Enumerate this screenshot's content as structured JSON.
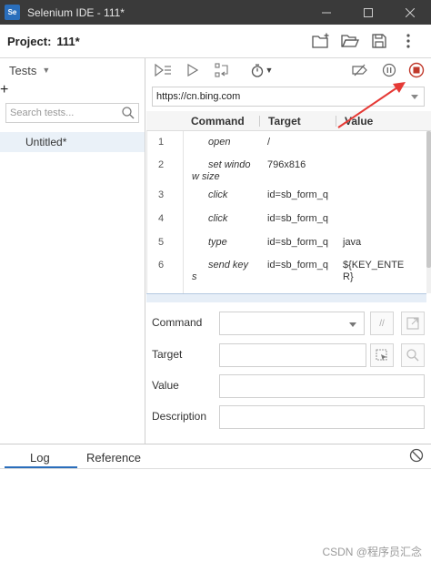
{
  "window": {
    "logo_text": "Se",
    "title": "Selenium IDE - 111*"
  },
  "project": {
    "label": "Project:",
    "name": "111*"
  },
  "sidebar": {
    "section_label": "Tests",
    "search_placeholder": "Search tests...",
    "tests": [
      {
        "name": "Untitled*",
        "selected": true
      }
    ]
  },
  "toolbar": {
    "url": "https://cn.bing.com"
  },
  "table": {
    "headers": {
      "command": "Command",
      "target": "Target",
      "value": "Value"
    },
    "rows": [
      {
        "num": "1",
        "command": "open",
        "target": "/",
        "value": ""
      },
      {
        "num": "2",
        "command": "set windo w size",
        "target": "796x816",
        "value": ""
      },
      {
        "num": "3",
        "command": "click",
        "target": "id=sb_form_q",
        "value": ""
      },
      {
        "num": "4",
        "command": "click",
        "target": "id=sb_form_q",
        "value": ""
      },
      {
        "num": "5",
        "command": "type",
        "target": "id=sb_form_q",
        "value": "java"
      },
      {
        "num": "6",
        "command": "send key s",
        "target": "id=sb_form_q",
        "value": "${KEY_ENTE R}"
      }
    ]
  },
  "editor": {
    "command_label": "Command",
    "target_label": "Target",
    "value_label": "Value",
    "description_label": "Description",
    "command_value": "",
    "target_value": "",
    "value_value": "",
    "description_value": "",
    "comment_button": "//"
  },
  "bottom_panel": {
    "tab_log": "Log",
    "tab_reference": "Reference",
    "active_tab": "Log"
  },
  "watermark": "CSDN @程序员汇念",
  "colors": {
    "accent": "#2a6ebb",
    "stop_record": "#c0392b",
    "annotation_arrow": "#e53935"
  }
}
